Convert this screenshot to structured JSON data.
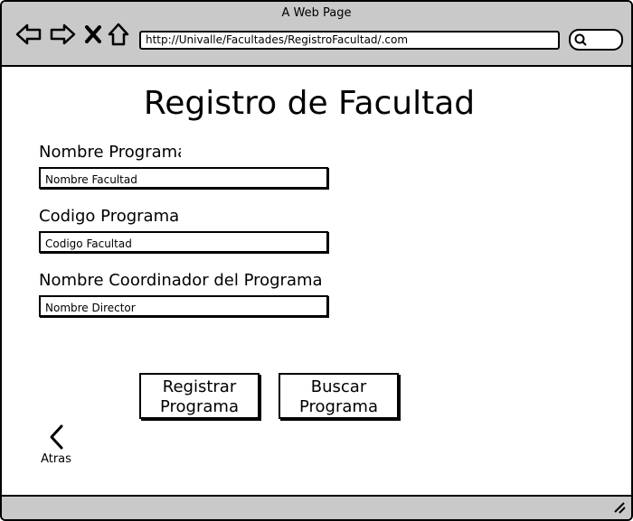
{
  "browser": {
    "title": "A Web Page",
    "url": "http://Univalle/Facultades/RegistroFacultad/.com"
  },
  "page": {
    "title": "Registro de Facultad"
  },
  "form": {
    "fields": [
      {
        "label": "Nombre Programa",
        "value": "Nombre Facultad"
      },
      {
        "label": "Codigo Programa",
        "value": "Codigo Facultad"
      },
      {
        "label": "Nombre Coordinador del Programa",
        "value": "Nombre Director"
      }
    ],
    "register_label_line1": "Registrar",
    "register_label_line2": "Programa",
    "search_label_line1": "Buscar",
    "search_label_line2": "Programa"
  },
  "back": {
    "label": "Atras"
  }
}
